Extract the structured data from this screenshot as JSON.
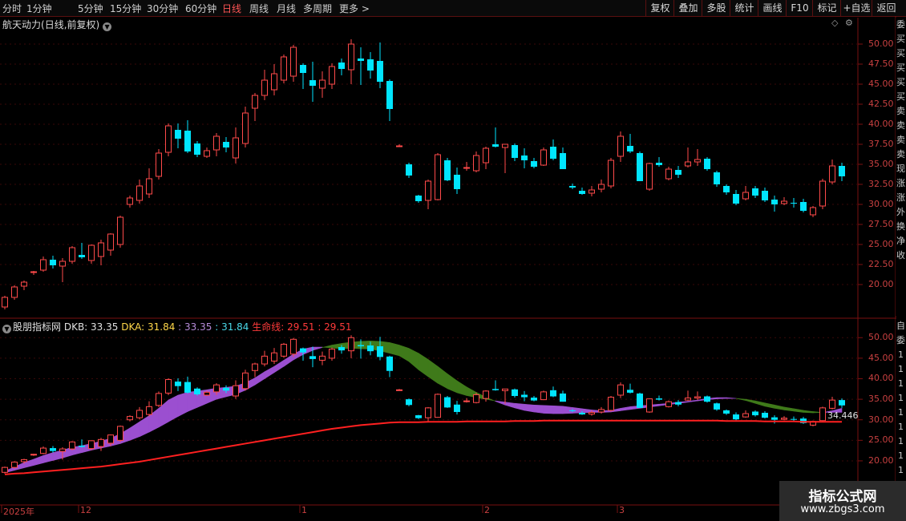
{
  "toolbar": {
    "periods": [
      {
        "label": "分时",
        "active": false
      },
      {
        "label": "1分钟",
        "active": false
      },
      {
        "label": "5分钟",
        "active": false
      },
      {
        "label": "15分钟",
        "active": false
      },
      {
        "label": "30分钟",
        "active": false
      },
      {
        "label": "60分钟",
        "active": false
      },
      {
        "label": "日线",
        "active": true
      },
      {
        "label": "周线",
        "active": false
      },
      {
        "label": "月线",
        "active": false
      },
      {
        "label": "多周期",
        "active": false
      },
      {
        "label": "更多 >",
        "active": false
      }
    ],
    "right_buttons": [
      "复权",
      "叠加",
      "多股",
      "统计",
      "画线",
      "F10",
      "标记",
      "+自选",
      "返回"
    ]
  },
  "main_panel": {
    "stock_name": "航天动力",
    "period_note": "(日线,前复权)",
    "y_labels": [
      "50.00",
      "47.50",
      "45.00",
      "42.50",
      "40.00",
      "37.50",
      "35.00",
      "32.50",
      "30.00",
      "27.50",
      "25.00",
      "22.50",
      "20.00"
    ],
    "right_strip_chars": [
      "委",
      "买",
      "买",
      "买",
      "买",
      "买",
      "卖",
      "卖",
      "卖",
      "卖",
      "现",
      "涨",
      "涨",
      "外",
      "换",
      "净",
      "收"
    ]
  },
  "indicator_panel": {
    "name": "股朋指标网",
    "dkb_label": "DKB: 33.35",
    "dka_label": "DKA: 31.84",
    "v1": ": 33.35",
    "v2": ": 31.84",
    "lifeline_label": "生命线: 29.51",
    "v3": ": 29.51",
    "y_labels": [
      "50.00",
      "45.00",
      "40.00",
      "35.00",
      "30.00",
      "25.00",
      "20.00"
    ],
    "right_strip_chars": [
      "自",
      "委",
      "1",
      "1",
      "1",
      "1",
      "1",
      "1",
      "1",
      "1",
      "1"
    ],
    "last_value": "34.446"
  },
  "x_axis": {
    "labels": [
      {
        "text": "2025年",
        "date_index": 0
      },
      {
        "text": "12",
        "date_index": 8
      },
      {
        "text": "1",
        "date_index": 31
      },
      {
        "text": "2",
        "date_index": 50
      },
      {
        "text": "3",
        "date_index": 64
      }
    ]
  },
  "watermark": {
    "title": "指标公式网",
    "url": "www.zbgs3.com"
  },
  "colors": {
    "up": "#ff4a4a",
    "down": "#00e5ff",
    "lifeline": "#ff2020",
    "band_up": "#9b4fd0",
    "band_down": "#3f7a1a",
    "axis": "#7a1010"
  },
  "chart_data": {
    "type": "candlestick",
    "ohlc": [
      [
        17.2,
        18.6,
        16.9,
        18.4
      ],
      [
        18.4,
        19.9,
        18.1,
        19.7
      ],
      [
        19.8,
        20.5,
        19.3,
        20.3
      ],
      [
        21.6,
        21.7,
        21.2,
        21.6
      ],
      [
        21.8,
        23.5,
        21.6,
        23.1
      ],
      [
        23.1,
        23.6,
        22.0,
        22.4
      ],
      [
        22.3,
        23.3,
        20.3,
        22.9
      ],
      [
        22.9,
        24.8,
        22.6,
        24.6
      ],
      [
        23.7,
        25.2,
        23.2,
        23.4
      ],
      [
        23.0,
        25.0,
        22.6,
        24.9
      ],
      [
        23.5,
        25.6,
        22.4,
        25.2
      ],
      [
        24.3,
        26.4,
        23.6,
        26.3
      ],
      [
        25.0,
        28.6,
        24.6,
        28.4
      ],
      [
        30.0,
        31.1,
        29.6,
        30.8
      ],
      [
        30.5,
        33.1,
        30.1,
        32.3
      ],
      [
        31.3,
        34.5,
        30.8,
        33.2
      ],
      [
        33.5,
        36.9,
        33.1,
        36.4
      ],
      [
        36.5,
        40.1,
        36.0,
        39.8
      ],
      [
        39.3,
        40.1,
        37.0,
        38.2
      ],
      [
        39.2,
        40.5,
        36.4,
        36.6
      ],
      [
        37.6,
        37.9,
        35.9,
        36.2
      ],
      [
        36.0,
        37.1,
        35.8,
        36.7
      ],
      [
        36.8,
        38.9,
        36.0,
        38.5
      ],
      [
        37.8,
        38.4,
        36.5,
        37.1
      ],
      [
        35.8,
        39.6,
        35.1,
        38.3
      ],
      [
        37.6,
        42.2,
        37.1,
        41.4
      ],
      [
        42.0,
        43.9,
        40.4,
        43.6
      ],
      [
        43.6,
        46.8,
        43.0,
        45.5
      ],
      [
        44.3,
        47.5,
        43.6,
        46.3
      ],
      [
        45.5,
        48.7,
        45.1,
        48.4
      ],
      [
        46.0,
        49.9,
        45.3,
        49.6
      ],
      [
        47.4,
        47.6,
        44.4,
        46.4
      ],
      [
        45.5,
        47.8,
        42.8,
        44.8
      ],
      [
        44.5,
        46.6,
        43.3,
        45.5
      ],
      [
        45.0,
        47.6,
        44.4,
        47.2
      ],
      [
        47.7,
        48.2,
        46.1,
        46.9
      ],
      [
        46.8,
        50.6,
        45.0,
        50.0
      ],
      [
        48.2,
        49.6,
        44.9,
        47.9
      ],
      [
        48.1,
        49.0,
        45.7,
        46.7
      ],
      [
        47.9,
        50.2,
        44.5,
        45.3
      ],
      [
        45.4,
        45.6,
        40.4,
        41.9
      ],
      [
        37.3,
        37.5,
        37.2,
        37.3
      ],
      [
        35.0,
        35.2,
        33.3,
        33.6
      ],
      [
        31.1,
        31.2,
        30.2,
        30.4
      ],
      [
        30.5,
        33.1,
        29.4,
        32.9
      ],
      [
        30.6,
        36.4,
        30.5,
        36.2
      ],
      [
        35.5,
        35.8,
        32.9,
        33.0
      ],
      [
        33.7,
        34.6,
        31.3,
        31.9
      ],
      [
        34.6,
        35.3,
        34.2,
        34.6
      ],
      [
        34.2,
        36.6,
        34.0,
        36.1
      ],
      [
        35.2,
        37.2,
        34.4,
        37.0
      ],
      [
        37.5,
        39.6,
        37.1,
        37.2
      ],
      [
        37.1,
        37.5,
        33.9,
        37.5
      ],
      [
        37.4,
        37.6,
        35.4,
        35.8
      ],
      [
        36.1,
        37.0,
        34.5,
        35.5
      ],
      [
        35.4,
        35.8,
        34.5,
        34.7
      ],
      [
        34.9,
        37.1,
        34.8,
        36.8
      ],
      [
        37.2,
        38.1,
        35.5,
        35.7
      ],
      [
        36.4,
        37.1,
        34.4,
        34.4
      ],
      [
        32.3,
        32.6,
        31.9,
        32.1
      ],
      [
        31.7,
        32.1,
        31.2,
        31.3
      ],
      [
        31.4,
        32.3,
        31.0,
        31.8
      ],
      [
        31.9,
        33.1,
        31.5,
        32.5
      ],
      [
        32.3,
        35.8,
        32.0,
        35.5
      ],
      [
        36.0,
        39.1,
        35.3,
        38.5
      ],
      [
        37.3,
        38.8,
        36.4,
        36.6
      ],
      [
        36.4,
        36.6,
        32.9,
        32.9
      ],
      [
        31.9,
        35.2,
        31.7,
        35.1
      ],
      [
        35.2,
        35.9,
        34.7,
        34.9
      ],
      [
        33.2,
        34.7,
        33.0,
        34.4
      ],
      [
        34.3,
        34.8,
        33.3,
        33.7
      ],
      [
        34.8,
        37.1,
        34.6,
        35.3
      ],
      [
        35.3,
        36.9,
        34.8,
        35.6
      ],
      [
        35.7,
        35.9,
        34.2,
        34.4
      ],
      [
        34.0,
        34.2,
        32.2,
        32.5
      ],
      [
        32.3,
        32.5,
        31.2,
        31.5
      ],
      [
        31.3,
        31.8,
        29.9,
        30.1
      ],
      [
        30.7,
        32.3,
        30.5,
        31.5
      ],
      [
        32.0,
        32.3,
        30.8,
        31.1
      ],
      [
        31.7,
        32.1,
        30.3,
        30.5
      ],
      [
        30.6,
        31.1,
        29.1,
        30.0
      ],
      [
        30.1,
        30.9,
        29.9,
        30.4
      ],
      [
        30.2,
        30.8,
        29.6,
        30.1
      ],
      [
        30.3,
        30.7,
        29.0,
        29.2
      ],
      [
        28.7,
        29.8,
        28.4,
        29.6
      ],
      [
        29.8,
        33.2,
        29.4,
        32.9
      ],
      [
        32.8,
        35.6,
        32.5,
        34.8
      ],
      [
        34.8,
        35.2,
        32.9,
        33.5
      ]
    ],
    "dkb": [
      17.5,
      18.5,
      19.6,
      20.4,
      21.3,
      22.0,
      22.6,
      23.3,
      23.7,
      24.2,
      24.8,
      25.5,
      26.6,
      28.0,
      29.5,
      31.0,
      32.8,
      34.8,
      36.0,
      36.7,
      37.0,
      37.3,
      37.7,
      37.9,
      38.2,
      39.0,
      40.2,
      41.7,
      43.0,
      44.5,
      46.0,
      47.2,
      47.7,
      47.7,
      47.5,
      47.3,
      47.4,
      47.3,
      47.2,
      46.8,
      46.2,
      45.6,
      44.2,
      42.2,
      40.5,
      38.9,
      37.6,
      36.6,
      35.9,
      35.4,
      35.0,
      34.6,
      34.3,
      34.0,
      33.8,
      33.6,
      33.5,
      33.4,
      33.3,
      33.0,
      32.7,
      32.4,
      32.2,
      32.3,
      32.8,
      33.2,
      33.4,
      33.6,
      33.8,
      34.0,
      34.3,
      34.5,
      34.8,
      35.2,
      35.4,
      35.4,
      35.2,
      34.7,
      34.0,
      33.3,
      32.8,
      32.4,
      32.1,
      31.8,
      31.7,
      31.8,
      32.2,
      32.8
    ],
    "dka": [
      17.1,
      17.7,
      18.3,
      18.9,
      19.5,
      20.1,
      20.7,
      21.4,
      22.0,
      22.6,
      23.1,
      23.6,
      24.2,
      25.0,
      25.9,
      27.0,
      28.2,
      29.5,
      30.8,
      32.0,
      33.0,
      34.0,
      35.0,
      35.6,
      36.2,
      37.2,
      38.5,
      40.0,
      41.5,
      43.0,
      44.6,
      45.9,
      46.9,
      47.6,
      48.2,
      48.6,
      48.9,
      49.1,
      49.2,
      49.1,
      48.8,
      48.2,
      47.4,
      46.2,
      44.7,
      43.0,
      41.2,
      39.5,
      38.0,
      36.7,
      35.5,
      34.5,
      33.6,
      32.9,
      32.3,
      31.9,
      31.6,
      31.5,
      31.5,
      31.6,
      31.7,
      31.8,
      31.8,
      31.9,
      32.2,
      32.5,
      32.8,
      33.1,
      33.4,
      33.7,
      34.0,
      34.3,
      34.6,
      34.9,
      35.1,
      35.2,
      35.2,
      35.0,
      34.6,
      34.1,
      33.6,
      33.1,
      32.7,
      32.3,
      32.0,
      31.8,
      31.8,
      31.8
    ],
    "lifeline": [
      16.7,
      16.9,
      17.0,
      17.2,
      17.4,
      17.6,
      17.8,
      18.0,
      18.2,
      18.4,
      18.6,
      18.9,
      19.2,
      19.5,
      19.8,
      20.2,
      20.6,
      21.0,
      21.4,
      21.8,
      22.2,
      22.6,
      23.0,
      23.4,
      23.8,
      24.2,
      24.6,
      25.0,
      25.4,
      25.8,
      26.2,
      26.6,
      27.0,
      27.4,
      27.8,
      28.1,
      28.4,
      28.7,
      28.9,
      29.1,
      29.3,
      29.4,
      29.4,
      29.4,
      29.5,
      29.5,
      29.5,
      29.5,
      29.6,
      29.6,
      29.6,
      29.6,
      29.6,
      29.7,
      29.7,
      29.7,
      29.8,
      29.8,
      29.8,
      29.8,
      29.8,
      29.8,
      29.8,
      29.8,
      29.8,
      29.8,
      29.8,
      29.8,
      29.8,
      29.8,
      29.8,
      29.8,
      29.8,
      29.8,
      29.8,
      29.7,
      29.7,
      29.7,
      29.7,
      29.6,
      29.6,
      29.6,
      29.6,
      29.5,
      29.5,
      29.5,
      29.5,
      29.5
    ],
    "main_ylim": [
      17.5,
      51.5
    ],
    "ind_ylim": [
      15.5,
      52.2
    ]
  }
}
